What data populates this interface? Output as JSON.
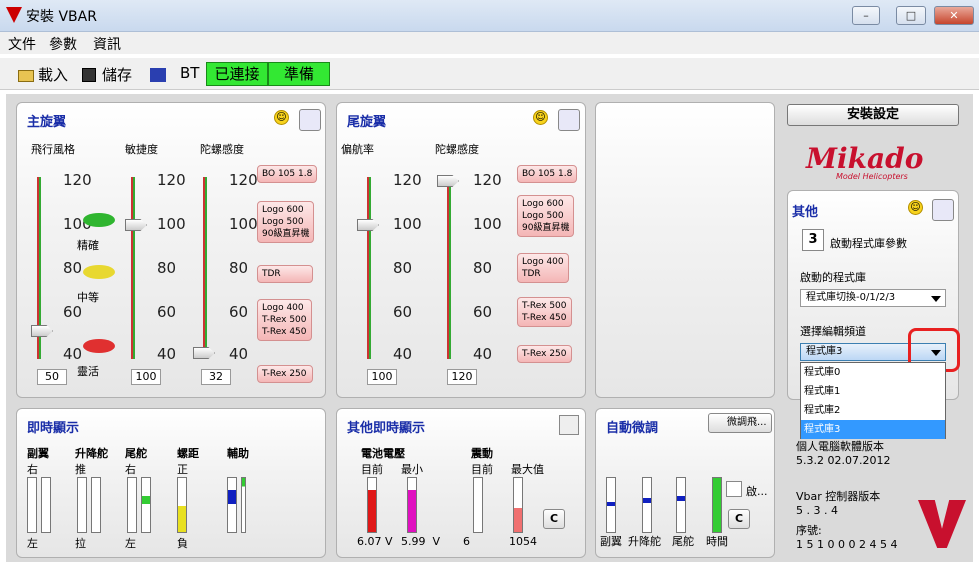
{
  "window": {
    "title": "安裝 VBAR",
    "minimize": "–",
    "restore": "□",
    "close": "✕"
  },
  "menu": [
    "文件",
    "參數",
    "資訊"
  ],
  "toolbar": {
    "load": "載入",
    "save": "儲存",
    "bt": "BT",
    "status_connected": "已連接",
    "status_ready": "準備"
  },
  "main_rotor": {
    "title": "主旋翼",
    "col1": "飛行風格",
    "col2": "敏捷度",
    "col3": "陀螺感度",
    "ticks": [
      "120",
      "100",
      "80",
      "60",
      "40"
    ],
    "style_labels": [
      "精確",
      "中等",
      "靈活"
    ],
    "values": [
      "50",
      "100",
      "32"
    ],
    "bubbles": [
      "BO 105 1.8",
      "Logo 600\nLogo 500\n90級直昇機",
      "TDR",
      "Logo 400\nT-Rex 500\nT-Rex 450",
      "T-Rex 250"
    ]
  },
  "tail_rotor": {
    "title": "尾旋翼",
    "col1": "偏航率",
    "col2": "陀螺感度",
    "ticks": [
      "120",
      "100",
      "80",
      "60",
      "40"
    ],
    "values": [
      "100",
      "120"
    ],
    "bubbles": [
      "BO 105 1.8",
      "Logo 600\nLogo 500\n90級直昇機",
      "Logo 400\nTDR",
      "T-Rex 500\nT-Rex 450",
      "T-Rex 250"
    ]
  },
  "setup": {
    "button": "安裝設定",
    "brand": "Mikado",
    "brand_sub": "Model Helicopters"
  },
  "other": {
    "title": "其他",
    "param_num": "3",
    "param_label": "啟動程式庫參數",
    "lib_label": "啟動的程式庫",
    "lib_value": "程式庫切換-0/1/2/3",
    "ch_label": "選擇編輯頻道",
    "ch_value": "程式庫3",
    "options": [
      "程式庫0",
      "程式庫1",
      "程式庫2",
      "程式庫3"
    ]
  },
  "live": {
    "title": "即時顯示",
    "cols": [
      "副翼",
      "升降舵",
      "尾舵",
      "螺距",
      "輔助"
    ],
    "top": [
      "右",
      "推",
      "右",
      "正",
      ""
    ],
    "bottom": [
      "左",
      "拉",
      "左",
      "負",
      ""
    ]
  },
  "other_live": {
    "title": "其他即時顯示",
    "battery": "電池電壓",
    "current": "目前",
    "min": "最小",
    "vib": "震動",
    "vib_cur": "目前",
    "vib_max": "最大值",
    "v1": "6.07",
    "v2": "5.99",
    "unit": "V",
    "vib_v1": "6",
    "vib_v2": "1054",
    "c": "C"
  },
  "auto_trim": {
    "title": "自動微調",
    "trim_btn": "微調飛...",
    "enable": "啟...",
    "labels": [
      "副翼",
      "升降舵",
      "尾舵",
      "時間"
    ],
    "c": "C"
  },
  "info": {
    "label1": "個人電腦軟體版本",
    "v1": "5.3.2  02.07.2012",
    "label2": "Vbar 控制器版本",
    "v2": "5 . 3 . 4",
    "label3": "序號:",
    "v3": "1 5 1 0 0 0 2 4 5 4"
  },
  "colors": {
    "green": "#33e833",
    "title_blue": "#1a2ea8"
  }
}
